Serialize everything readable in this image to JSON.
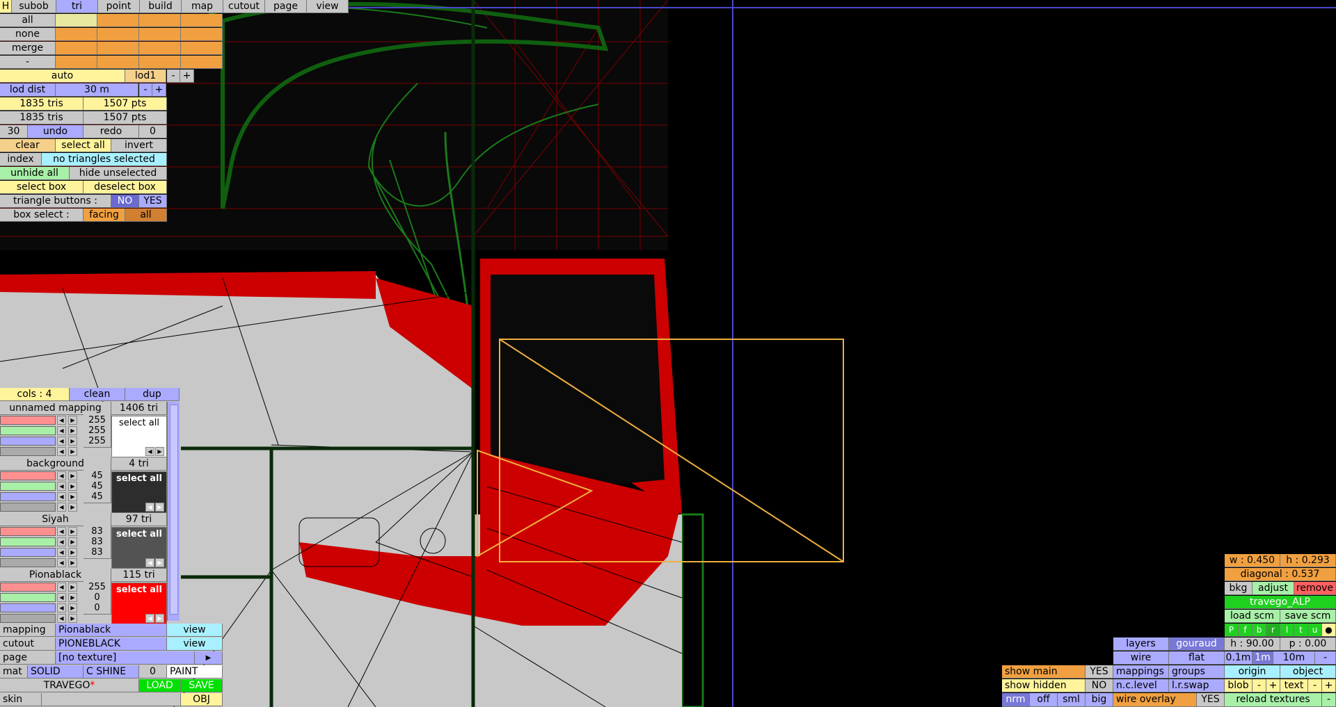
{
  "menu": {
    "h": "H",
    "tabs": [
      "subob",
      "tri",
      "point",
      "build",
      "map",
      "cutout",
      "page",
      "view"
    ],
    "active_tab": "tri"
  },
  "sel_rows": [
    "all",
    "none",
    "merge",
    "-"
  ],
  "lod": {
    "auto": "auto",
    "lod": "lod1",
    "minus": "-",
    "plus": "+",
    "dist_label": "lod dist",
    "dist_value": "30 m"
  },
  "stats": {
    "tris1": "1835 tris",
    "pts1": "1507 pts",
    "tris2": "1835 tris",
    "pts2": "1507 pts"
  },
  "undo": {
    "count": "30",
    "undo": "undo",
    "redo": "redo",
    "redo_count": "0"
  },
  "tri_actions": {
    "clear": "clear",
    "select_all": "select all",
    "invert": "invert",
    "index": "index",
    "status": "no triangles selected",
    "unhide_all": "unhide all",
    "hide_unselected": "hide unselected",
    "select_box": "select box",
    "deselect_box": "deselect box"
  },
  "tri_buttons": {
    "label": "triangle buttons :",
    "no": "NO",
    "yes": "YES"
  },
  "box_select": {
    "label": "box select :",
    "facing": "facing",
    "all": "all"
  },
  "cols_bar": {
    "cols": "cols : 4",
    "clean": "clean",
    "dup": "dup"
  },
  "materials": [
    {
      "name": "unnamed mapping",
      "tri": "1406 tri",
      "r": "255",
      "g": "255",
      "b": "255",
      "select": "select all",
      "color": "#ffffff",
      "text": "#000000"
    },
    {
      "name": "background",
      "tri": "4 tri",
      "r": "45",
      "g": "45",
      "b": "45",
      "select": "select all",
      "color": "#2d2d2d",
      "text": "#ffffff"
    },
    {
      "name": "Siyah",
      "tri": "97 tri",
      "r": "83",
      "g": "83",
      "b": "83",
      "select": "select all",
      "color": "#535353",
      "text": "#ffffff"
    },
    {
      "name": "Pionablack",
      "tri": "115 tri",
      "r": "255",
      "g": "0",
      "b": "0",
      "select": "select all",
      "color": "#ff0000",
      "text": "#ffffff"
    }
  ],
  "bottom_left": {
    "mapping_label": "mapping",
    "mapping_value": "Pionablack",
    "view1": "view",
    "cutout_label": "cutout",
    "cutout_value": "PIONEBLACK",
    "view2": "view",
    "page_label": "page",
    "page_value": "[no texture]",
    "page_arrow": "▶",
    "mat": "mat",
    "solid": "SOLID",
    "cshine": "C SHINE",
    "zero": "0",
    "paint": "PAINT",
    "project": "TRAVEGO",
    "star": "*",
    "load": "LOAD",
    "save": "SAVE",
    "skin": "skin",
    "obj": "OBJ"
  },
  "right_panel": {
    "w": "w : 0.450",
    "h": "h : 0.293",
    "diagonal": "diagonal : 0.537",
    "bkg": "bkg",
    "adjust": "adjust",
    "remove": "remove",
    "model": "travego_ALP",
    "load_scm": "load scm",
    "save_scm": "save scm",
    "views": [
      "P",
      "f",
      "b",
      "r",
      "l",
      "t",
      "u",
      "●"
    ],
    "layers": "layers",
    "gouraud": "gouraud",
    "heading": "h : 90.00",
    "pitch": "p : 0.00",
    "wire": "wire",
    "flat": "flat",
    "step1": "0.1m",
    "step2": "1m",
    "step3": "10m",
    "step_minus": "-",
    "show_main": "show main",
    "show_main_v": "YES",
    "mappings": "mappings",
    "groups": "groups",
    "origin": "origin",
    "object": "object",
    "show_hidden": "show hidden",
    "show_hidden_v": "NO",
    "nclevel": "n.c.level",
    "lrswap": "l.r.swap",
    "blob": "blob",
    "bminus": "-",
    "bplus": "+",
    "text": "text",
    "tminus": "-",
    "tplus": "+",
    "nrm": "nrm",
    "off": "off",
    "sml": "sml",
    "big": "big",
    "wire_overlay": "wire overlay",
    "wire_overlay_v": "YES",
    "reload": "reload textures",
    "rminus": "-"
  }
}
